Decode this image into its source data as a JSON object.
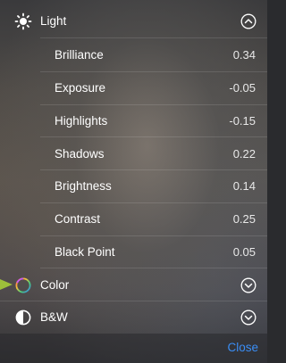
{
  "light": {
    "label": "Light",
    "icon": "sun-icon",
    "expanded": true,
    "adjustments": [
      {
        "label": "Brilliance",
        "value": "0.34"
      },
      {
        "label": "Exposure",
        "value": "-0.05"
      },
      {
        "label": "Highlights",
        "value": "-0.15"
      },
      {
        "label": "Shadows",
        "value": "0.22"
      },
      {
        "label": "Brightness",
        "value": "0.14"
      },
      {
        "label": "Contrast",
        "value": "0.25"
      },
      {
        "label": "Black Point",
        "value": "0.05"
      }
    ]
  },
  "color": {
    "label": "Color",
    "icon": "color-wheel-icon"
  },
  "bw": {
    "label": "B&W",
    "icon": "half-circle-icon"
  },
  "footer": {
    "close_label": "Close"
  },
  "colors": {
    "accent": "#3a8ef6",
    "pointer": "#9dc03a"
  }
}
